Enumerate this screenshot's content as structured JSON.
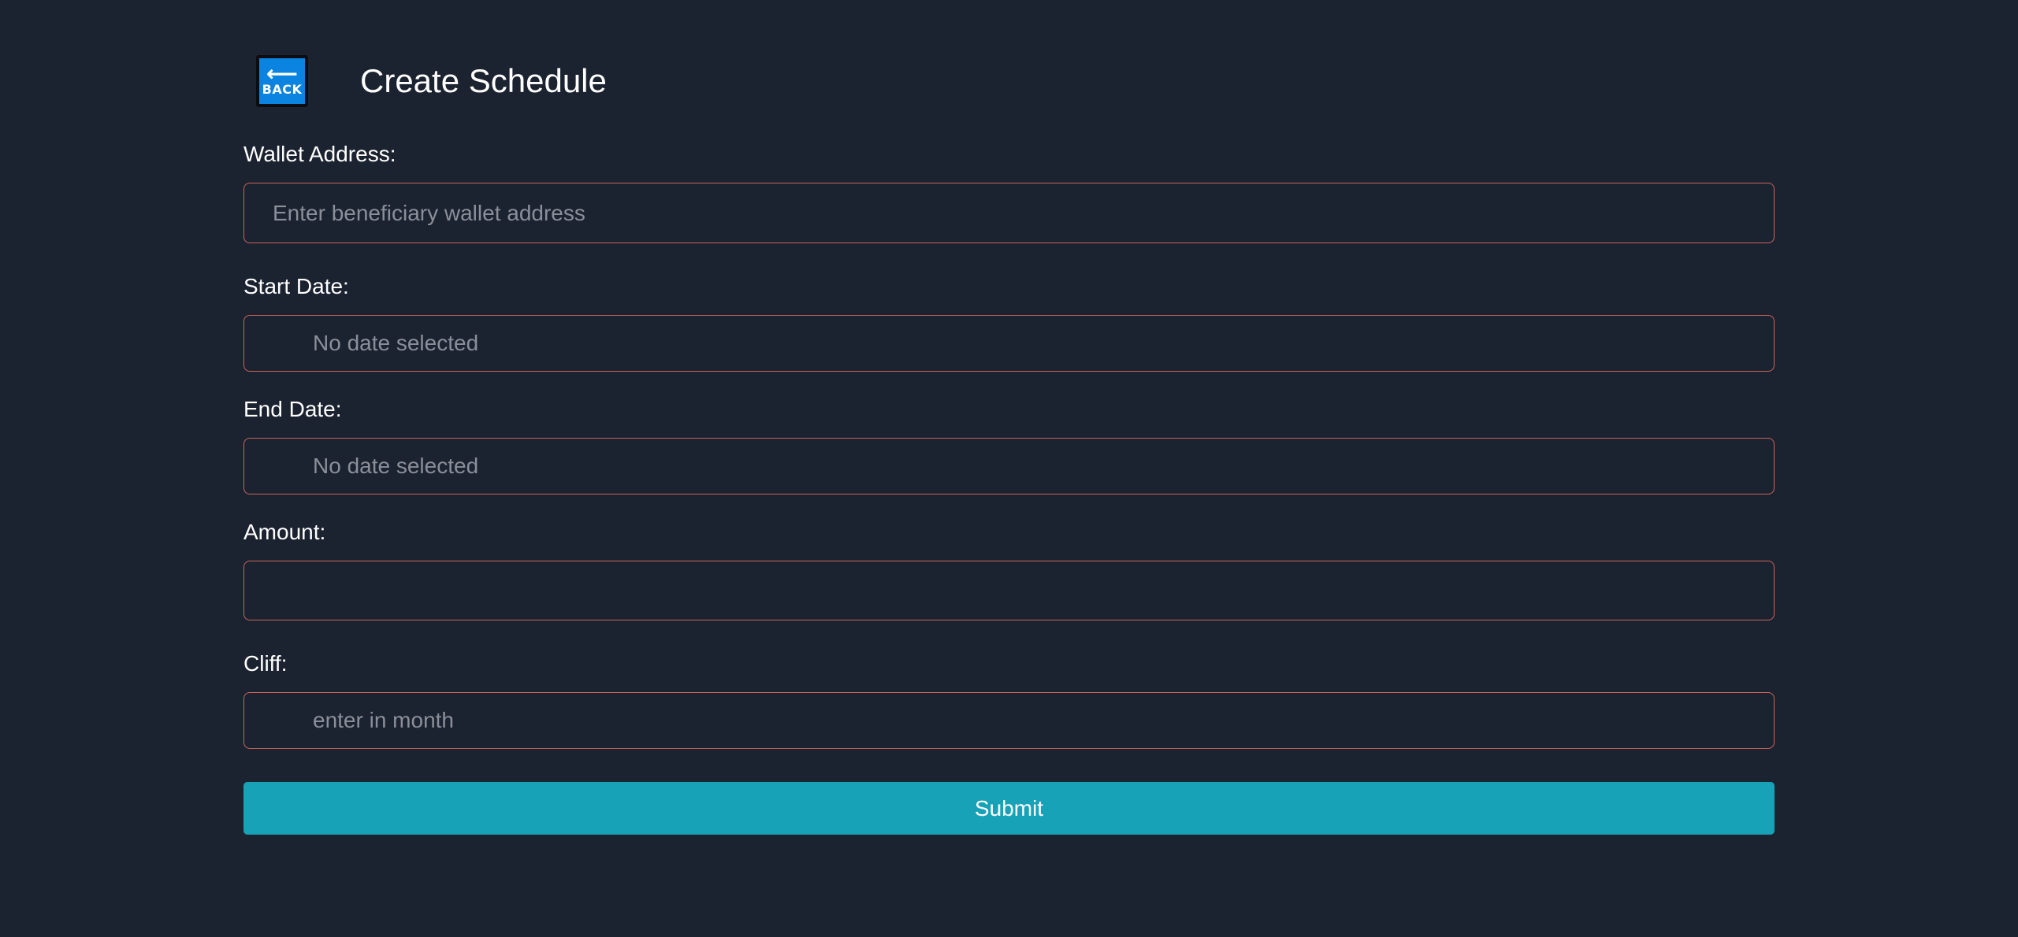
{
  "header": {
    "back_arrow": "⟵",
    "back_label": "BACK",
    "title": "Create Schedule"
  },
  "form": {
    "wallet": {
      "label": "Wallet Address:",
      "placeholder": "Enter beneficiary wallet address",
      "value": ""
    },
    "start_date": {
      "label": "Start Date:",
      "placeholder": "No date selected",
      "value": ""
    },
    "end_date": {
      "label": "End Date:",
      "placeholder": "No date selected",
      "value": ""
    },
    "amount": {
      "label": "Amount:",
      "placeholder": "",
      "value": ""
    },
    "cliff": {
      "label": "Cliff:",
      "placeholder": "enter in month",
      "value": ""
    },
    "submit_label": "Submit"
  },
  "colors": {
    "background": "#1c2330",
    "field_border": "#c8645a",
    "submit_bg": "#17a2b8",
    "back_button_bg": "#0a84e0"
  }
}
